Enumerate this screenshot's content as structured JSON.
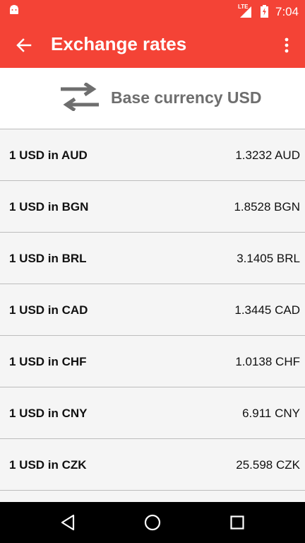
{
  "status_bar": {
    "network": "LTE",
    "time": "7:04"
  },
  "toolbar": {
    "title": "Exchange rates",
    "back_icon": "arrow-back-icon",
    "more_icon": "more-vert-icon"
  },
  "base_header": {
    "icon": "swap-arrows-icon",
    "label": "Base currency USD"
  },
  "rates": [
    {
      "pair": "1 USD in AUD",
      "value": "1.3232 AUD"
    },
    {
      "pair": "1 USD in BGN",
      "value": "1.8528 BGN"
    },
    {
      "pair": "1 USD in BRL",
      "value": "3.1405 BRL"
    },
    {
      "pair": "1 USD in CAD",
      "value": "1.3445 CAD"
    },
    {
      "pair": "1 USD in CHF",
      "value": "1.0138 CHF"
    },
    {
      "pair": "1 USD in CNY",
      "value": "6.911 CNY"
    },
    {
      "pair": "1 USD in CZK",
      "value": "25.598 CZK"
    }
  ],
  "colors": {
    "primary": "#f44336",
    "header_text": "#6e6e6e",
    "list_bg": "#f5f5f5"
  }
}
